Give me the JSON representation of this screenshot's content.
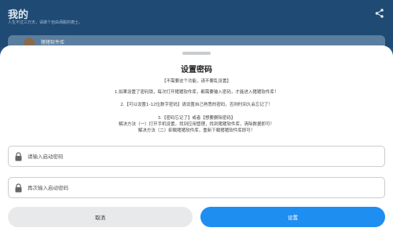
{
  "background": {
    "title": "我的",
    "subtitle": "人生不过三万天，请做个自由洒脱的爬士。",
    "card_label": "猪猪软件库"
  },
  "dialog": {
    "title": "设置密码",
    "lines": [
      "【不需要这个功能，请不要乱设置】",
      "1.如果设置了密码锁，每次打开猪猪软件库，都需要输入密码，才能进入猪猪软件库！",
      "2.【可以设置1-12位数字密码】请设置自己熟悉的密码，否则时间久会忘记了！",
      "3.【密码忘记了】或者【想要删除密码】",
      "解决方法（一）打开手机设置，找到应用管理，找到猪猪软件库，清除数据即可！",
      "解决方法（二）卸载猪猪软件库，重新下载猪猪软件库即可！"
    ],
    "password_placeholder": "请输入启动密码",
    "confirm_placeholder": "再次输入启动密码",
    "cancel_label": "取消",
    "confirm_label": "设置"
  },
  "colors": {
    "accent": "#1f8ef1",
    "overlay": "#25507a"
  },
  "icons": {
    "share": "share-icon",
    "lock": "lock-icon"
  }
}
